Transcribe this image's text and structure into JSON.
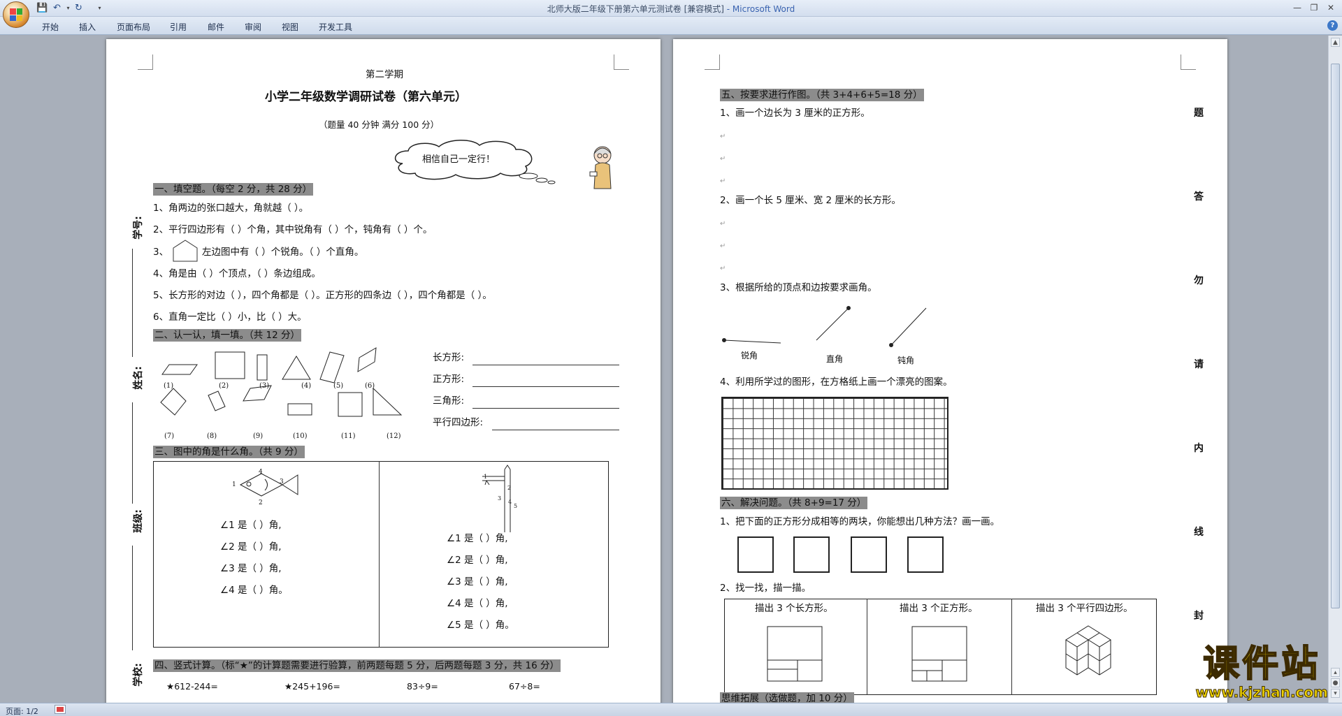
{
  "window": {
    "title": "北师大版二年级下册第六单元测试卷 [兼容模式]",
    "app": " - Microsoft Word"
  },
  "ribbon": {
    "tabs": [
      "开始",
      "插入",
      "页面布局",
      "引用",
      "邮件",
      "审阅",
      "视图",
      "开发工具"
    ]
  },
  "status": {
    "page": "页面: 1/2"
  },
  "page1": {
    "term": "第二学期",
    "title": "小学二年级数学调研试卷（第六单元）",
    "subtitle": "（题量 40 分钟  满分 100 分）",
    "cloud": "相信自己一定行！",
    "side": [
      "学号:",
      "姓名:",
      "班级:",
      "学校:"
    ],
    "s1": {
      "h": "一、填空题。（每空 2 分，共 28 分）",
      "q": [
        "1、角两边的张口越大，角就越（     ）。",
        "2、平行四边形有（     ）个角，其中锐角有（     ）个，钝角有（     ）个。",
        "3、",
        "左边图中有（     ）个锐角。（     ）个直角。",
        "4、角是由（     ）个顶点，（     ）条边组成。",
        "5、长方形的对边（     ），四个角都是（     ）。正方形的四条边（     ），四个角都是（     ）。",
        "6、直角一定比（     ）小，比（     ）大。"
      ]
    },
    "s2": {
      "h": "二、认一认，填一填。（共 12 分）",
      "labels": [
        "(1)",
        "(2)",
        "(3)",
        "(4)",
        "(5)",
        "(6)",
        "(7)",
        "(8)",
        "(9)",
        "(10)",
        "(11)",
        "(12)"
      ],
      "fill": [
        "长方形:",
        "正方形:",
        "三角形:",
        "平行四边形:"
      ]
    },
    "s3": {
      "h": "三、图中的角是什么角。（共 9 分）",
      "left": [
        "∠1 是（     ）角,",
        "∠2 是（     ）角,",
        "∠3 是（     ）角,",
        "∠4 是（     ）角。"
      ],
      "right": [
        "∠1 是（     ）角,",
        "∠2 是（     ）角,",
        "∠3 是（     ）角,",
        "∠4 是（     ）角,",
        "∠5 是（     ）角。"
      ],
      "fishnums": [
        "1",
        "2",
        "3",
        "4"
      ],
      "polenums": [
        "1",
        "2",
        "3",
        "4",
        "5"
      ]
    },
    "s4": {
      "h": "四、竖式计算。（标“★”的计算题需要进行验算，前两题每题 5 分，后两题每题 3 分，共 16 分）",
      "q": [
        "★612-244=",
        "★245+196=",
        "83÷9=",
        "67÷8="
      ]
    }
  },
  "page2": {
    "s5": {
      "h": "五、按要求进行作图。（共 3+4+6+5=18 分）",
      "q": [
        "1、画一个边长为 3 厘米的正方形。",
        "2、画一个长 5 厘米、宽 2 厘米的长方形。",
        "3、根据所给的顶点和边按要求画角。",
        "4、利用所学过的图形，在方格纸上画一个漂亮的图案。"
      ],
      "angles": [
        "锐角",
        "直角",
        "钝角"
      ]
    },
    "s6": {
      "h": "六、解决问题。（共 8+9=17 分）",
      "q": [
        "1、把下面的正方形分成相等的两块，你能想出几种方法？画一画。",
        "2、找一找，描一描。"
      ],
      "cells": [
        "描出 3 个长方形。",
        "描出 3 个正方形。",
        "描出 3 个平行四边形。"
      ]
    },
    "s7": {
      "h": "思维拓展（选做题，加 10 分）"
    },
    "side": [
      "题",
      "答",
      "勿",
      "请",
      "内",
      "线",
      "封"
    ]
  },
  "watermark": {
    "text": "课件站",
    "url": "www.kjzhan.com"
  }
}
